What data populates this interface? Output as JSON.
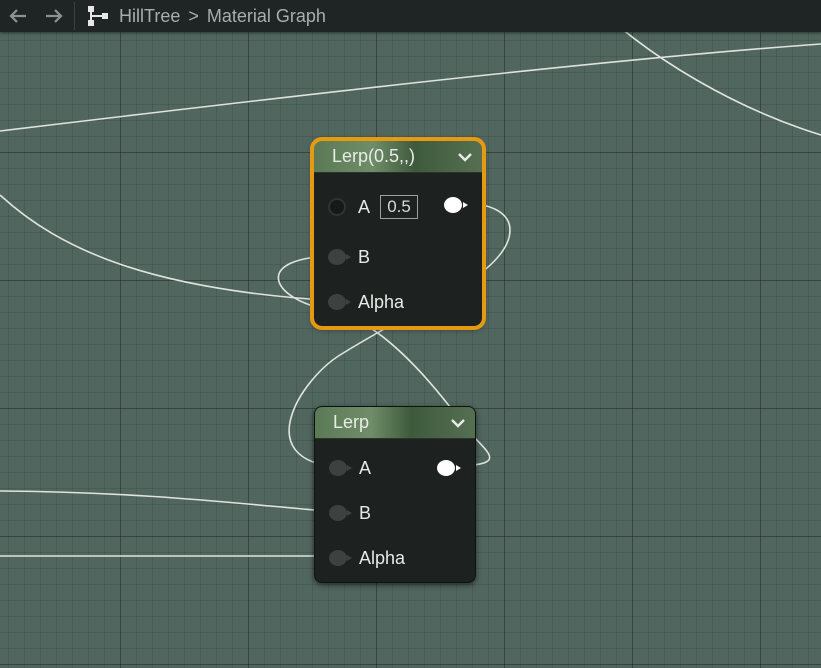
{
  "toolbar": {
    "back_icon": "arrow-left-icon",
    "forward_icon": "arrow-right-icon",
    "graph_icon": "graph-hierarchy-icon",
    "breadcrumb": [
      "HillTree",
      "Material Graph"
    ],
    "separator": ">"
  },
  "nodes": [
    {
      "title": "Lerp(0.5,,)",
      "selected": true,
      "inputs": [
        {
          "label": "A",
          "value": "0.5"
        },
        {
          "label": "B"
        },
        {
          "label": "Alpha"
        }
      ]
    },
    {
      "title": "Lerp",
      "selected": false,
      "inputs": [
        {
          "label": "A"
        },
        {
          "label": "B"
        },
        {
          "label": "Alpha"
        }
      ]
    }
  ],
  "colors": {
    "canvas": "#51665e",
    "selection": "#e69a12",
    "wire": "#dfe3df"
  }
}
